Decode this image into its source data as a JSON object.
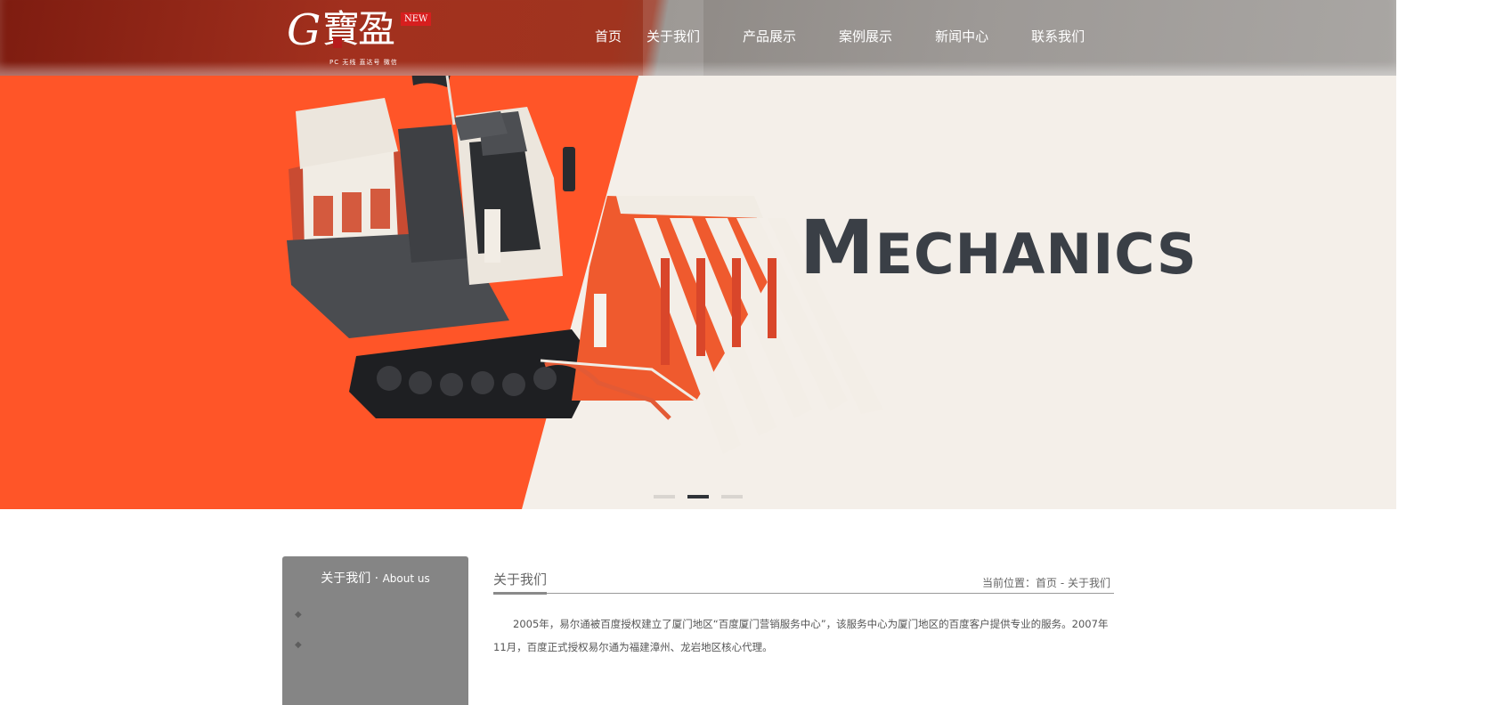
{
  "header": {
    "logo": {
      "brand": "G寶盈",
      "badge": "NEW",
      "subtitle": "PC 无线 直达号 微信"
    },
    "nav": [
      {
        "label": "首页",
        "active": false
      },
      {
        "label": "关于我们",
        "active": true
      },
      {
        "label": "产品展示",
        "active": false
      },
      {
        "label": "案例展示",
        "active": false
      },
      {
        "label": "新闻中心",
        "active": false
      },
      {
        "label": "联系我们",
        "active": false
      }
    ]
  },
  "banner": {
    "headline_first": "M",
    "headline_rest": "ECHANICS",
    "slides": 3,
    "active_slide": 2,
    "colors": {
      "accent": "#ff5528",
      "background": "#f4efe9",
      "text": "#3a3f46"
    }
  },
  "sidebar": {
    "title_cn": "关于我们",
    "title_sep": " · ",
    "title_en": "About us",
    "items": [
      {
        "bullet": "◆",
        "label": ""
      },
      {
        "bullet": "◆",
        "label": ""
      }
    ]
  },
  "main": {
    "title": "关于我们",
    "breadcrumb": {
      "prefix": "当前位置：",
      "home": "首页",
      "sep": " - ",
      "current": "关于我们"
    },
    "paragraph": "2005年，易尔通被百度授权建立了厦门地区“百度厦门营销服务中心”，该服务中心为厦门地区的百度客户提供专业的服务。2007年11月，百度正式授权易尔通为福建漳州、龙岩地区核心代理。"
  }
}
